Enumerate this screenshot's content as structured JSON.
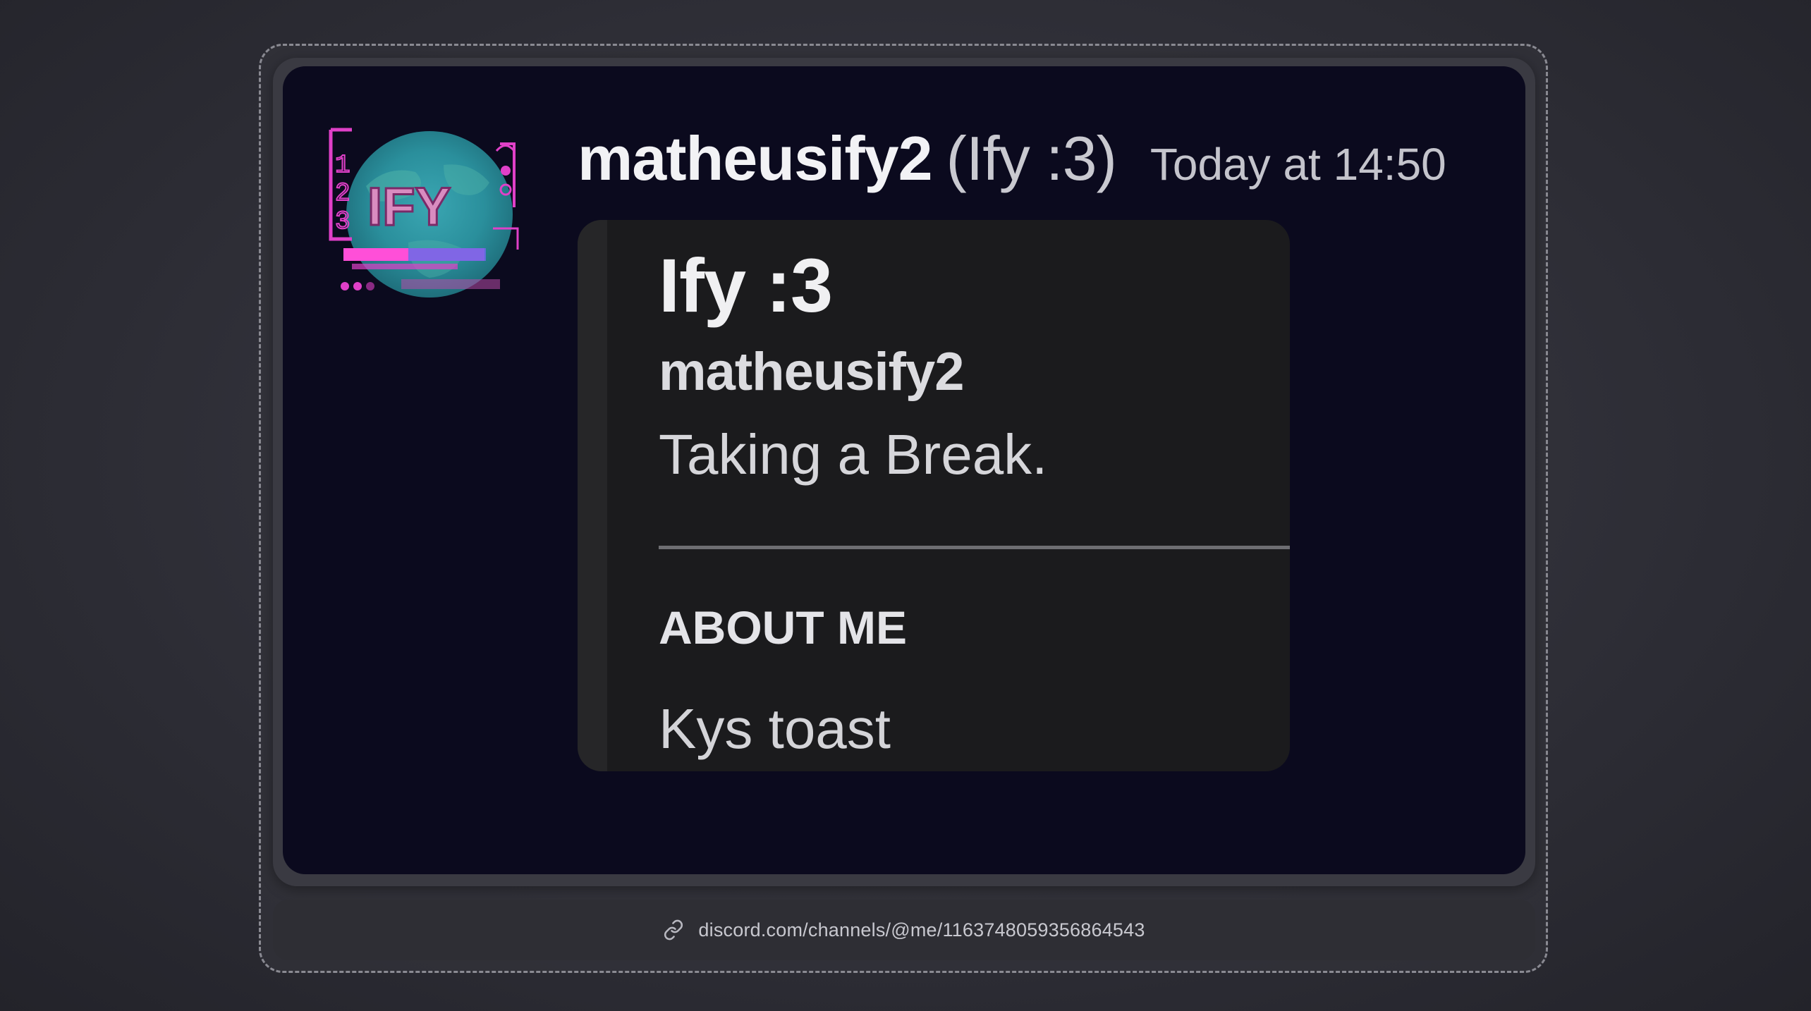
{
  "message": {
    "username": "matheusify2",
    "nickname": "(Ify :3)",
    "timestamp": "Today at 14:50",
    "avatar": {
      "icon": "avatar-ify-logo",
      "text": "IFY"
    }
  },
  "embed": {
    "title": "Ify :3",
    "username": "matheusify2",
    "status": "Taking a Break.",
    "section_heading": "ABOUT ME",
    "about_text": "Kys toast"
  },
  "footer": {
    "link_icon": "link-icon",
    "link_text": "discord.com/channels/@me/1163748059356864543"
  },
  "colors": {
    "card_background": "#0b0a1e",
    "embed_background": "#1b1b1d",
    "avatar_accent_pink": "#e040c8",
    "avatar_accent_teal": "#2a8f9c"
  }
}
